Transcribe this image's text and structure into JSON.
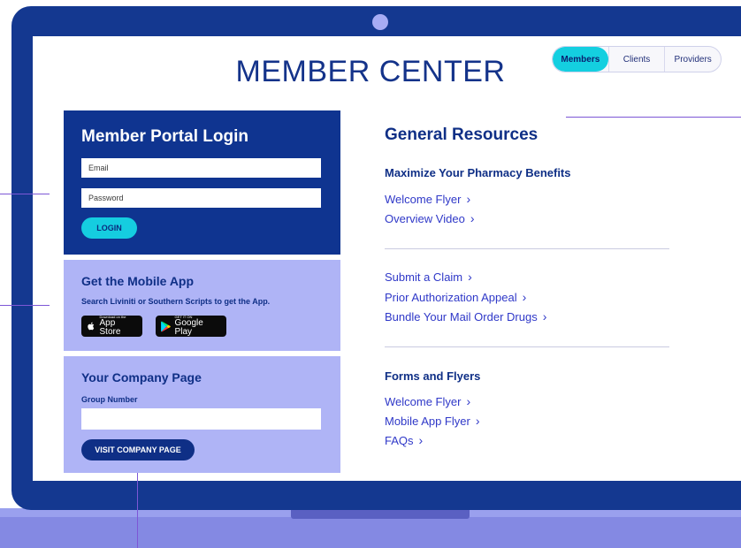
{
  "header": {
    "title": "MEMBER CENTER",
    "tabs": [
      {
        "label": "Members",
        "active": true
      },
      {
        "label": "Clients",
        "active": false
      },
      {
        "label": "Providers",
        "active": false
      }
    ]
  },
  "login": {
    "title": "Member Portal Login",
    "email_placeholder": "Email",
    "password_placeholder": "Password",
    "button_label": "LOGIN"
  },
  "mobile_app": {
    "title": "Get the Mobile App",
    "subtitle": "Search Liviniti or Southern Scripts to get the App.",
    "app_store": {
      "small": "Download on the",
      "big": "App Store"
    },
    "google_play": {
      "small": "GET IT ON",
      "big": "Google Play"
    }
  },
  "company": {
    "title": "Your Company Page",
    "group_label": "Group Number",
    "button_label": "VISIT COMPANY PAGE"
  },
  "resources": {
    "title": "General Resources",
    "sections": [
      {
        "heading": "Maximize Your Pharmacy Benefits",
        "links": [
          "Welcome Flyer",
          "Overview Video"
        ]
      },
      {
        "heading": "",
        "links": [
          "Submit a Claim",
          "Prior Authorization Appeal",
          "Bundle Your Mail Order Drugs"
        ]
      },
      {
        "heading": "Forms and Flyers",
        "links": [
          "Welcome Flyer",
          "Mobile App Flyer",
          "FAQs"
        ]
      }
    ]
  },
  "colors": {
    "navy": "#0f3490",
    "frame": "#143890",
    "cyan": "#15cde0",
    "lavender": "#afb4f6",
    "link": "#2f38c8",
    "callout": "#7d57d6"
  }
}
